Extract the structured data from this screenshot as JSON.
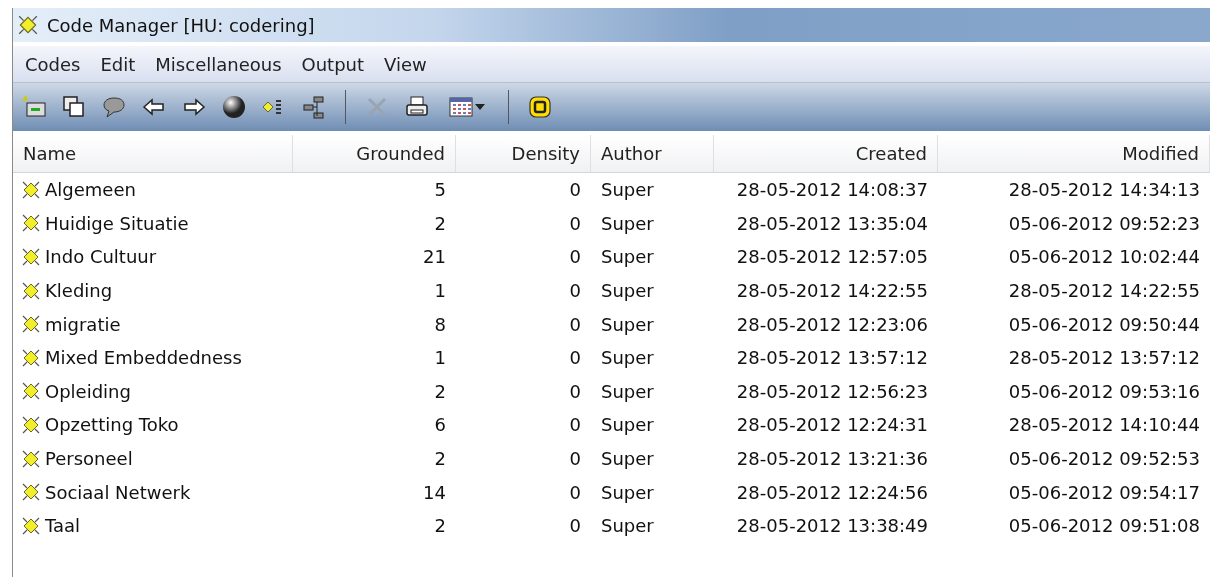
{
  "window": {
    "title": "Code Manager [HU: codering]"
  },
  "menu": [
    "Codes",
    "Edit",
    "Miscellaneous",
    "Output",
    "View"
  ],
  "toolbar": [
    {
      "kind": "new"
    },
    {
      "kind": "copy"
    },
    {
      "kind": "comment"
    },
    {
      "kind": "back"
    },
    {
      "kind": "forward"
    },
    {
      "kind": "sphere"
    },
    {
      "kind": "list"
    },
    {
      "kind": "tree"
    },
    {
      "kind": "sep"
    },
    {
      "kind": "delete",
      "disabled": true
    },
    {
      "kind": "print"
    },
    {
      "kind": "calendar"
    },
    {
      "kind": "sep"
    },
    {
      "kind": "code"
    }
  ],
  "table": {
    "columns": [
      "Name",
      "Grounded",
      "Density",
      "Author",
      "Created",
      "Modified"
    ],
    "rows": [
      [
        "Algemeen",
        "5",
        "0",
        "Super",
        "28-05-2012 14:08:37",
        "28-05-2012 14:34:13"
      ],
      [
        "Huidige Situatie",
        "2",
        "0",
        "Super",
        "28-05-2012 13:35:04",
        "05-06-2012 09:52:23"
      ],
      [
        "Indo Cultuur",
        "21",
        "0",
        "Super",
        "28-05-2012 12:57:05",
        "05-06-2012 10:02:44"
      ],
      [
        "Kleding",
        "1",
        "0",
        "Super",
        "28-05-2012 14:22:55",
        "28-05-2012 14:22:55"
      ],
      [
        "migratie",
        "8",
        "0",
        "Super",
        "28-05-2012 12:23:06",
        "05-06-2012 09:50:44"
      ],
      [
        "Mixed Embeddedness",
        "1",
        "0",
        "Super",
        "28-05-2012 13:57:12",
        "28-05-2012 13:57:12"
      ],
      [
        "Opleiding",
        "2",
        "0",
        "Super",
        "28-05-2012 12:56:23",
        "05-06-2012 09:53:16"
      ],
      [
        "Opzetting Toko",
        "6",
        "0",
        "Super",
        "28-05-2012 12:24:31",
        "28-05-2012 14:10:44"
      ],
      [
        "Personeel",
        "2",
        "0",
        "Super",
        "28-05-2012 13:21:36",
        "05-06-2012 09:52:53"
      ],
      [
        "Sociaal Netwerk",
        "14",
        "0",
        "Super",
        "28-05-2012 12:24:56",
        "05-06-2012 09:54:17"
      ],
      [
        "Taal",
        "2",
        "0",
        "Super",
        "28-05-2012 13:38:49",
        "05-06-2012 09:51:08"
      ]
    ]
  }
}
